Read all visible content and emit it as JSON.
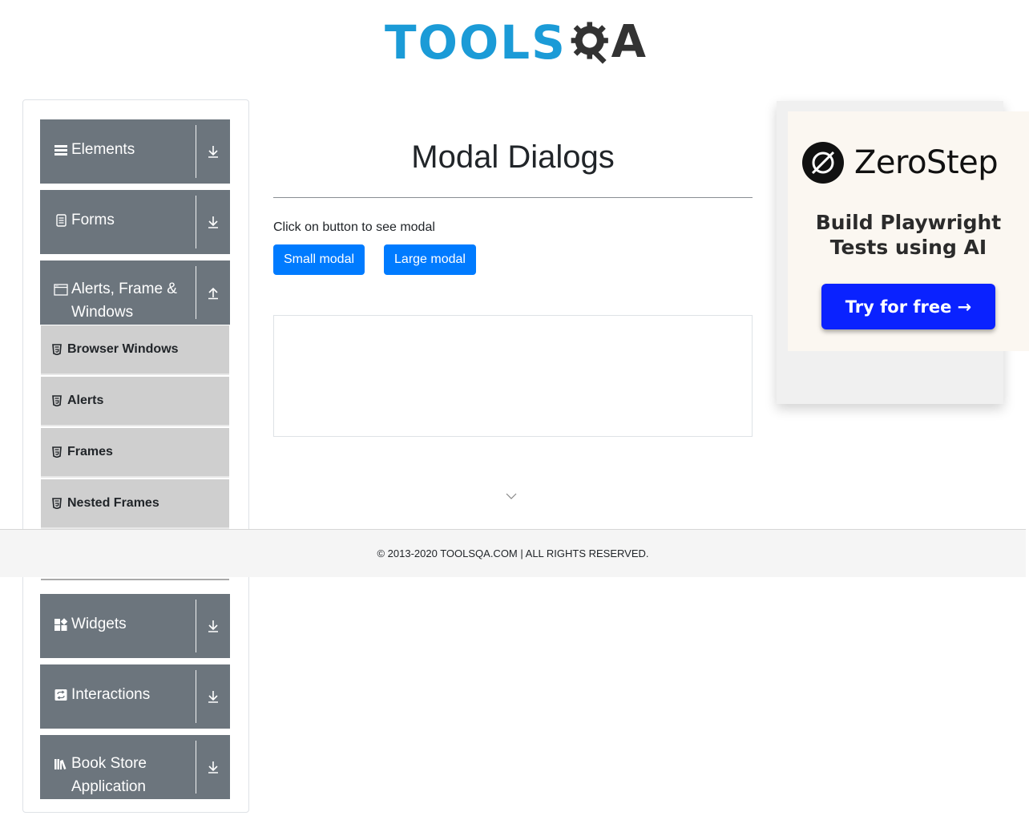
{
  "header": {
    "logo_text_primary": "TOOLS",
    "logo_text_secondary": "A",
    "logo_icon": "gear-magnifier-icon"
  },
  "sidebar": {
    "groups": [
      {
        "label": "Elements",
        "icon": "hamburger-icon",
        "toggle_icon": "download-arrow-icon"
      },
      {
        "label": "Forms",
        "icon": "document-icon",
        "toggle_icon": "download-arrow-icon"
      },
      {
        "label": "Alerts, Frame & Windows",
        "icon": "window-icon",
        "toggle_icon": "upload-arrow-icon"
      },
      {
        "label": "Widgets",
        "icon": "widgets-icon",
        "toggle_icon": "download-arrow-icon"
      },
      {
        "label": "Interactions",
        "icon": "interactions-icon",
        "toggle_icon": "download-arrow-icon"
      },
      {
        "label": "Book Store Application",
        "icon": "books-icon",
        "toggle_icon": "download-arrow-icon"
      }
    ],
    "sub_items": [
      {
        "label": "Browser Windows",
        "icon": "html5-icon"
      },
      {
        "label": "Alerts",
        "icon": "html5-icon"
      },
      {
        "label": "Frames",
        "icon": "html5-icon"
      },
      {
        "label": "Nested Frames",
        "icon": "html5-icon"
      }
    ]
  },
  "main": {
    "title": "Modal Dialogs",
    "prompt": "Click on button to see modal",
    "small_modal_label": "Small modal",
    "large_modal_label": "Large modal"
  },
  "ad": {
    "brand": "ZeroStep",
    "headline_line1": "Build Playwright",
    "headline_line2": "Tests using AI",
    "cta": "Try for free →",
    "colors": {
      "cta": "#0a22ff",
      "card": "#fbf7f1"
    }
  },
  "footer": {
    "text": "© 2013-2020 TOOLSQA.COM | ALL RIGHTS RESERVED."
  },
  "colors": {
    "primary_button": "#007bff",
    "sidebar_header": "#6c757d",
    "logo_blue": "#1b9bd7"
  }
}
